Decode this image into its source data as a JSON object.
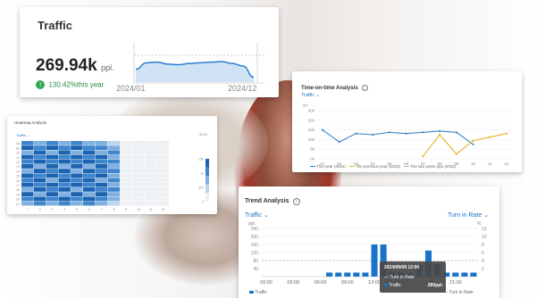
{
  "traffic_card": {
    "title": "Traffic",
    "value": "269.94k",
    "unit": "ppl.",
    "growth": "130.42%this year",
    "x_start": "2024/01",
    "x_end": "2024/12",
    "sparkline": [
      60,
      40,
      38,
      44,
      46,
      42,
      40,
      38,
      36,
      42,
      50,
      85
    ]
  },
  "time_on_time": {
    "title": "Time-on-time Analysis",
    "info_icon": "info-icon",
    "metric": "Traffic",
    "unit_label": "ppl.",
    "y_ticks": [
      "40k",
      "32k",
      "24k",
      "16k",
      "8k",
      "0k"
    ],
    "x_ticks": [
      "01",
      "02",
      "03",
      "04",
      "05",
      "06",
      "07",
      "08",
      "09",
      "10",
      "11",
      "12"
    ],
    "legend": [
      "This year (2024)",
      "The previous year (2023)",
      "The two years ago (2022)"
    ],
    "colors": {
      "this_year": "#3a86c8",
      "previous_year": "#e8b32a",
      "two_years_ago": "#8fb3d6"
    },
    "chart_data": {
      "type": "line",
      "x": [
        "01",
        "02",
        "03",
        "04",
        "05",
        "06",
        "07",
        "08",
        "09",
        "10",
        "11",
        "12"
      ],
      "ylim": [
        0,
        40
      ],
      "series": [
        {
          "name": "This year (2024)",
          "values": [
            24,
            14,
            21,
            20,
            22,
            21,
            22,
            23,
            22,
            12,
            null,
            null
          ]
        },
        {
          "name": "The previous year (2023)",
          "values": [
            null,
            null,
            null,
            null,
            null,
            null,
            2,
            20,
            4,
            15,
            18,
            21
          ]
        }
      ]
    }
  },
  "heatmap": {
    "title": "Heatmap Analysis",
    "metric": "Traffic",
    "year_label": "2024",
    "row_labels": [
      "08",
      "09",
      "10",
      "11",
      "12",
      "13",
      "14",
      "15",
      "16",
      "17",
      "18",
      "19",
      "20",
      "21"
    ],
    "col_labels": [
      "1",
      "2",
      "3",
      "4",
      "5",
      "6",
      "7",
      "8",
      "9",
      "10",
      "11",
      "12"
    ],
    "scale_labels": [
      "1.5k",
      "1k",
      "500",
      "0"
    ],
    "cell_levels": [
      [
        3,
        2,
        3,
        2,
        3,
        2,
        2,
        1,
        0,
        0,
        0,
        0
      ],
      [
        4,
        3,
        4,
        3,
        4,
        3,
        3,
        2,
        0,
        0,
        0,
        0
      ],
      [
        2,
        4,
        2,
        4,
        2,
        4,
        2,
        3,
        0,
        0,
        0,
        0
      ],
      [
        4,
        3,
        4,
        3,
        4,
        3,
        4,
        2,
        0,
        0,
        0,
        0
      ],
      [
        3,
        4,
        3,
        4,
        3,
        4,
        3,
        3,
        0,
        0,
        0,
        0
      ],
      [
        4,
        2,
        4,
        2,
        4,
        2,
        4,
        2,
        0,
        0,
        0,
        0
      ],
      [
        2,
        4,
        3,
        4,
        2,
        4,
        3,
        3,
        0,
        0,
        0,
        0
      ],
      [
        4,
        3,
        4,
        3,
        4,
        3,
        4,
        2,
        0,
        0,
        0,
        0
      ],
      [
        3,
        4,
        2,
        4,
        3,
        4,
        2,
        3,
        0,
        0,
        0,
        0
      ],
      [
        4,
        3,
        4,
        3,
        4,
        3,
        4,
        2,
        0,
        0,
        0,
        0
      ],
      [
        2,
        4,
        3,
        4,
        2,
        4,
        3,
        3,
        0,
        0,
        0,
        0
      ],
      [
        4,
        2,
        4,
        2,
        4,
        2,
        4,
        2,
        0,
        0,
        0,
        0
      ],
      [
        3,
        4,
        3,
        4,
        3,
        4,
        3,
        2,
        0,
        0,
        0,
        0
      ],
      [
        2,
        3,
        2,
        3,
        2,
        3,
        2,
        1,
        0,
        0,
        0,
        0
      ]
    ],
    "palette": [
      "#eef1f4",
      "#bcd6ee",
      "#7fb0df",
      "#3f86cc",
      "#1c63b1"
    ]
  },
  "trend": {
    "title": "Trend Analysis",
    "left_metric": "Traffic",
    "right_metric": "Turn in Rate",
    "left_unit": "ppl.",
    "right_unit": "%",
    "y_left": [
      "240",
      "200",
      "160",
      "120",
      "80",
      "40"
    ],
    "y_right": [
      "12",
      "10",
      "8",
      "6",
      "4",
      "2"
    ],
    "x_ticks": [
      "00:00",
      "03:00",
      "06:00",
      "09:00",
      "12:00",
      "15:00",
      "18:00",
      "21:00"
    ],
    "legend_left": "Traffic",
    "legend_right": "Turn in Rate",
    "tooltip": {
      "date": "2024/09/09 12:00",
      "row1_label": "Turn in Rate",
      "row2_label": "Traffic",
      "row2_value": "280ppl."
    },
    "bar_color": "#1a73c9",
    "chart_data": {
      "type": "bar",
      "categories": [
        "00:00",
        "01:00",
        "02:00",
        "03:00",
        "04:00",
        "05:00",
        "06:00",
        "07:00",
        "08:00",
        "09:00",
        "10:00",
        "11:00",
        "12:00",
        "13:00",
        "14:00",
        "15:00",
        "16:00",
        "17:00",
        "18:00",
        "19:00",
        "20:00",
        "21:00",
        "22:00",
        "23:00"
      ],
      "values": [
        0,
        0,
        0,
        0,
        0,
        0,
        0,
        20,
        20,
        20,
        20,
        20,
        160,
        160,
        20,
        20,
        20,
        60,
        130,
        60,
        20,
        20,
        20,
        20
      ],
      "ylim": [
        0,
        240
      ]
    }
  }
}
